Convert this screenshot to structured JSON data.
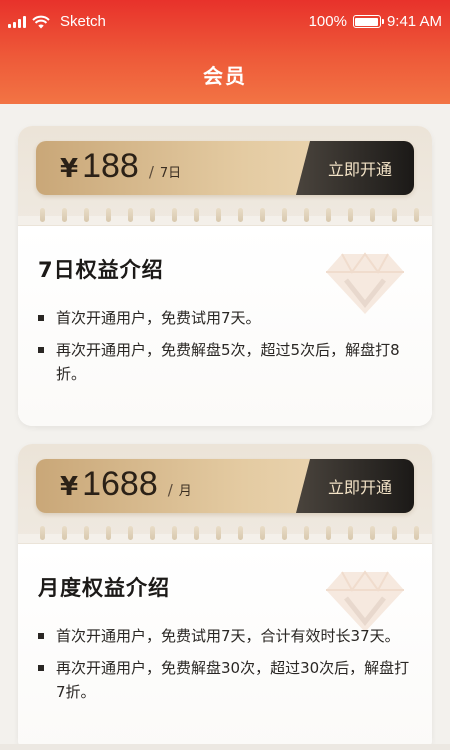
{
  "status": {
    "carrier": "Sketch",
    "battery_text": "100%",
    "time": "9:41 AM"
  },
  "header": {
    "title": "会员"
  },
  "cards": [
    {
      "currency": "¥",
      "amount": "188",
      "slash": "/",
      "period": "7日",
      "button": "立即开通",
      "section_title": "7日权益介绍",
      "bullets": [
        "首次开通用户，免费试用7天。",
        "再次开通用户，免费解盘5次，超过5次后，解盘打8折。"
      ]
    },
    {
      "currency": "¥",
      "amount": "1688",
      "slash": "/",
      "period": "月",
      "button": "立即开通",
      "section_title": "月度权益介绍",
      "bullets": [
        "首次开通用户，免费试用7天，合计有效时长37天。",
        "再次开通用户，免费解盘30次，超过30次后，解盘打7折。"
      ]
    }
  ],
  "colors": {
    "header_red": "#e8322b",
    "gold": "#d9bb8b",
    "button_dark": "#1b1917",
    "button_text": "#f3e3c7"
  },
  "icons": [
    "signal-icon",
    "wifi-icon",
    "battery-icon",
    "diamond-icon"
  ]
}
